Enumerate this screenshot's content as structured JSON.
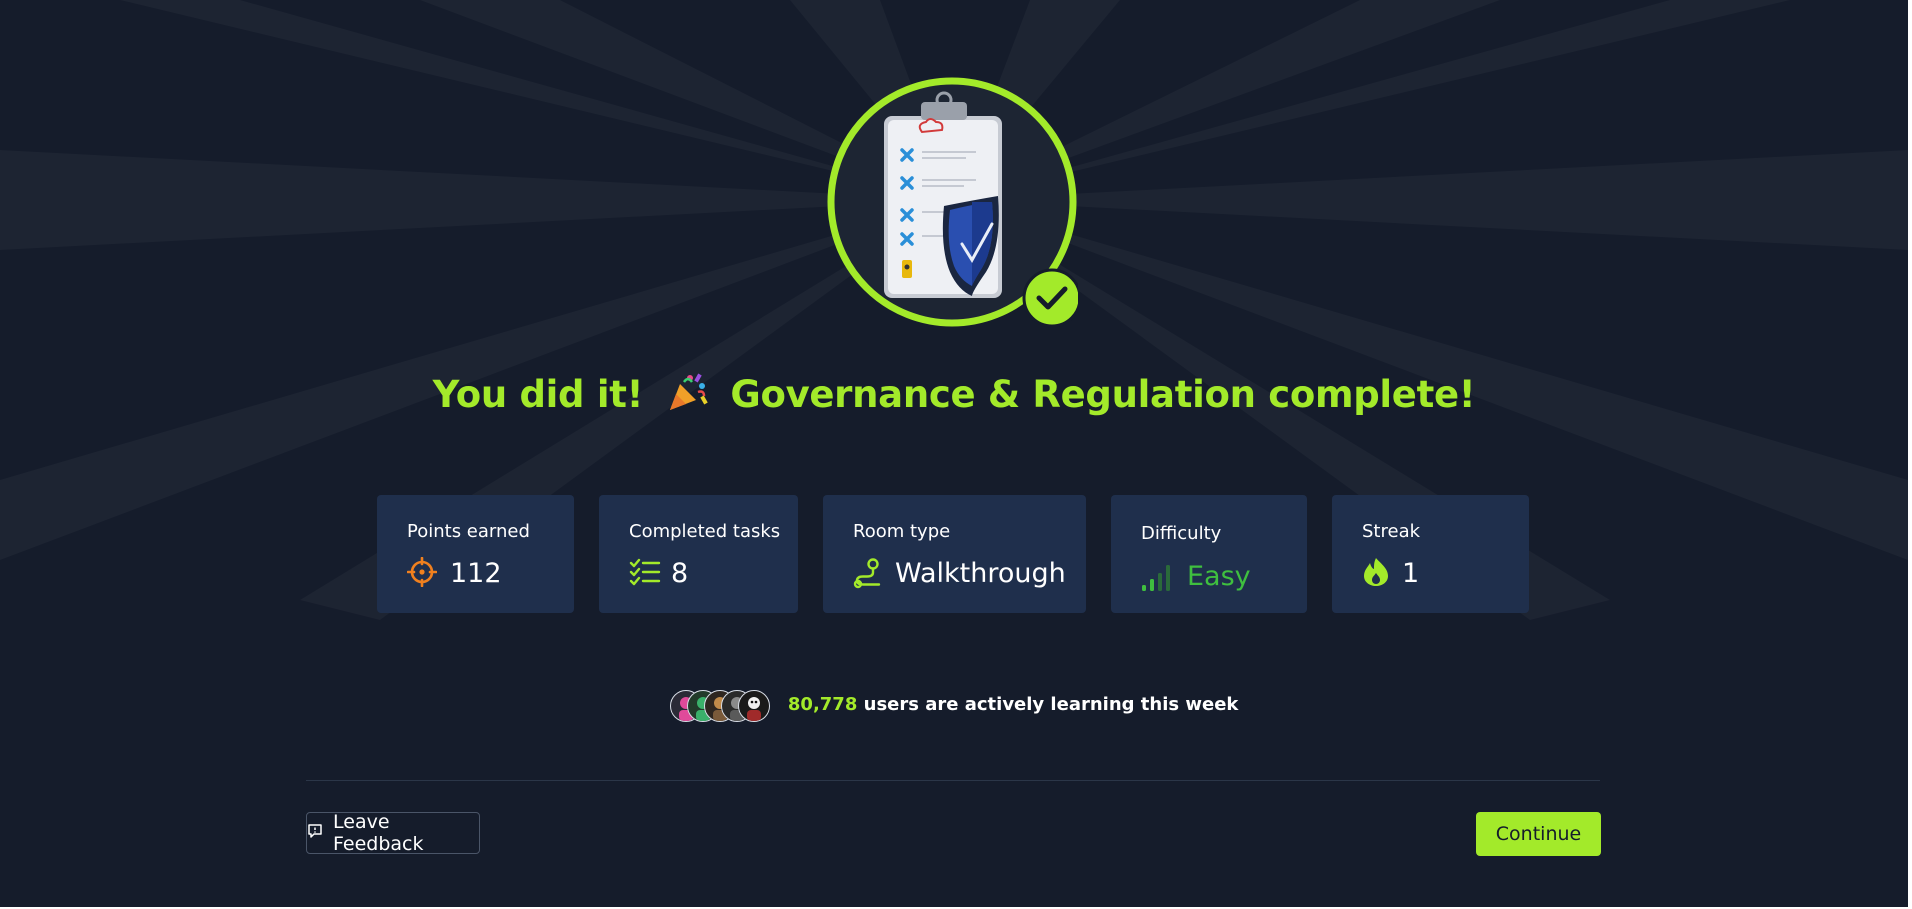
{
  "headline": {
    "prefix": "You did it!",
    "suffix": "Governance & Regulation complete!"
  },
  "stats": [
    {
      "label": "Points earned",
      "value": "112",
      "icon": "crosshair-icon"
    },
    {
      "label": "Completed tasks",
      "value": "8",
      "icon": "checklist-icon"
    },
    {
      "label": "Room type",
      "value": "Walkthrough",
      "icon": "route-icon"
    },
    {
      "label": "Difficulty",
      "value": "Easy",
      "icon": "signal-bars-icon"
    },
    {
      "label": "Streak",
      "value": "1",
      "icon": "flame-icon"
    }
  ],
  "learners": {
    "count": "80,778",
    "text": "users are actively learning this week"
  },
  "buttons": {
    "feedback": "Leave Feedback",
    "continue": "Continue"
  },
  "colors": {
    "background": "#151c2b",
    "accent": "#a3ea2a",
    "card": "#1f2f4c",
    "points_icon": "#f0801e",
    "difficulty": "#3fbf3f"
  }
}
